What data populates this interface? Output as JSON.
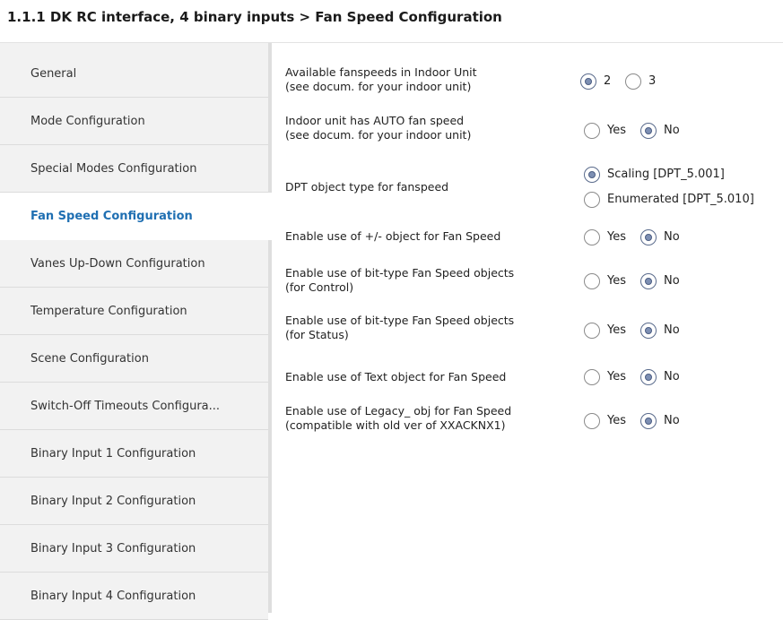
{
  "header": {
    "title": "1.1.1 DK RC interface, 4 binary inputs > Fan Speed Configuration"
  },
  "sidebar": {
    "items": [
      {
        "label": "General"
      },
      {
        "label": "Mode Configuration"
      },
      {
        "label": "Special Modes Configuration"
      },
      {
        "label": "Fan Speed Configuration",
        "active": true
      },
      {
        "label": "Vanes Up-Down Configuration"
      },
      {
        "label": "Temperature Configuration"
      },
      {
        "label": "Scene Configuration"
      },
      {
        "label": "Switch-Off Timeouts Configura..."
      },
      {
        "label": "Binary Input 1 Configuration"
      },
      {
        "label": "Binary Input 2 Configuration"
      },
      {
        "label": "Binary Input 3 Configuration"
      },
      {
        "label": "Binary Input 4 Configuration"
      }
    ]
  },
  "params": [
    {
      "label_line1": "Available fanspeeds in Indoor Unit",
      "label_line2": "(see docum. for your indoor unit)",
      "options": [
        {
          "label": "2",
          "checked": true
        },
        {
          "label": "3",
          "checked": false
        }
      ]
    },
    {
      "label_line1": "Indoor unit has AUTO fan speed",
      "label_line2": "(see docum. for your indoor unit)",
      "options": [
        {
          "label": "Yes",
          "checked": false
        },
        {
          "label": "No",
          "checked": true
        }
      ]
    },
    {
      "label_line1": "DPT object type for fanspeed",
      "options": [
        {
          "label": "Scaling [DPT_5.001]",
          "checked": true
        },
        {
          "label": "Enumerated [DPT_5.010]",
          "checked": false
        }
      ]
    },
    {
      "label_line1": "Enable use of +/- object for Fan Speed",
      "options": [
        {
          "label": "Yes",
          "checked": false
        },
        {
          "label": "No",
          "checked": true
        }
      ]
    },
    {
      "label_line1": "Enable use of bit-type Fan Speed objects",
      "label_line2": "(for Control)",
      "options": [
        {
          "label": "Yes",
          "checked": false
        },
        {
          "label": "No",
          "checked": true
        }
      ]
    },
    {
      "label_line1": "Enable use of bit-type Fan Speed objects",
      "label_line2": "(for Status)",
      "options": [
        {
          "label": "Yes",
          "checked": false
        },
        {
          "label": "No",
          "checked": true
        }
      ]
    },
    {
      "label_line1": "Enable use of Text object for Fan Speed",
      "options": [
        {
          "label": "Yes",
          "checked": false
        },
        {
          "label": "No",
          "checked": true
        }
      ]
    },
    {
      "label_line1": "Enable use of Legacy_ obj for Fan Speed",
      "label_line2": "(compatible with old ver of XXACKNX1)",
      "options": [
        {
          "label": "Yes",
          "checked": false
        },
        {
          "label": "No",
          "checked": true
        }
      ]
    }
  ]
}
